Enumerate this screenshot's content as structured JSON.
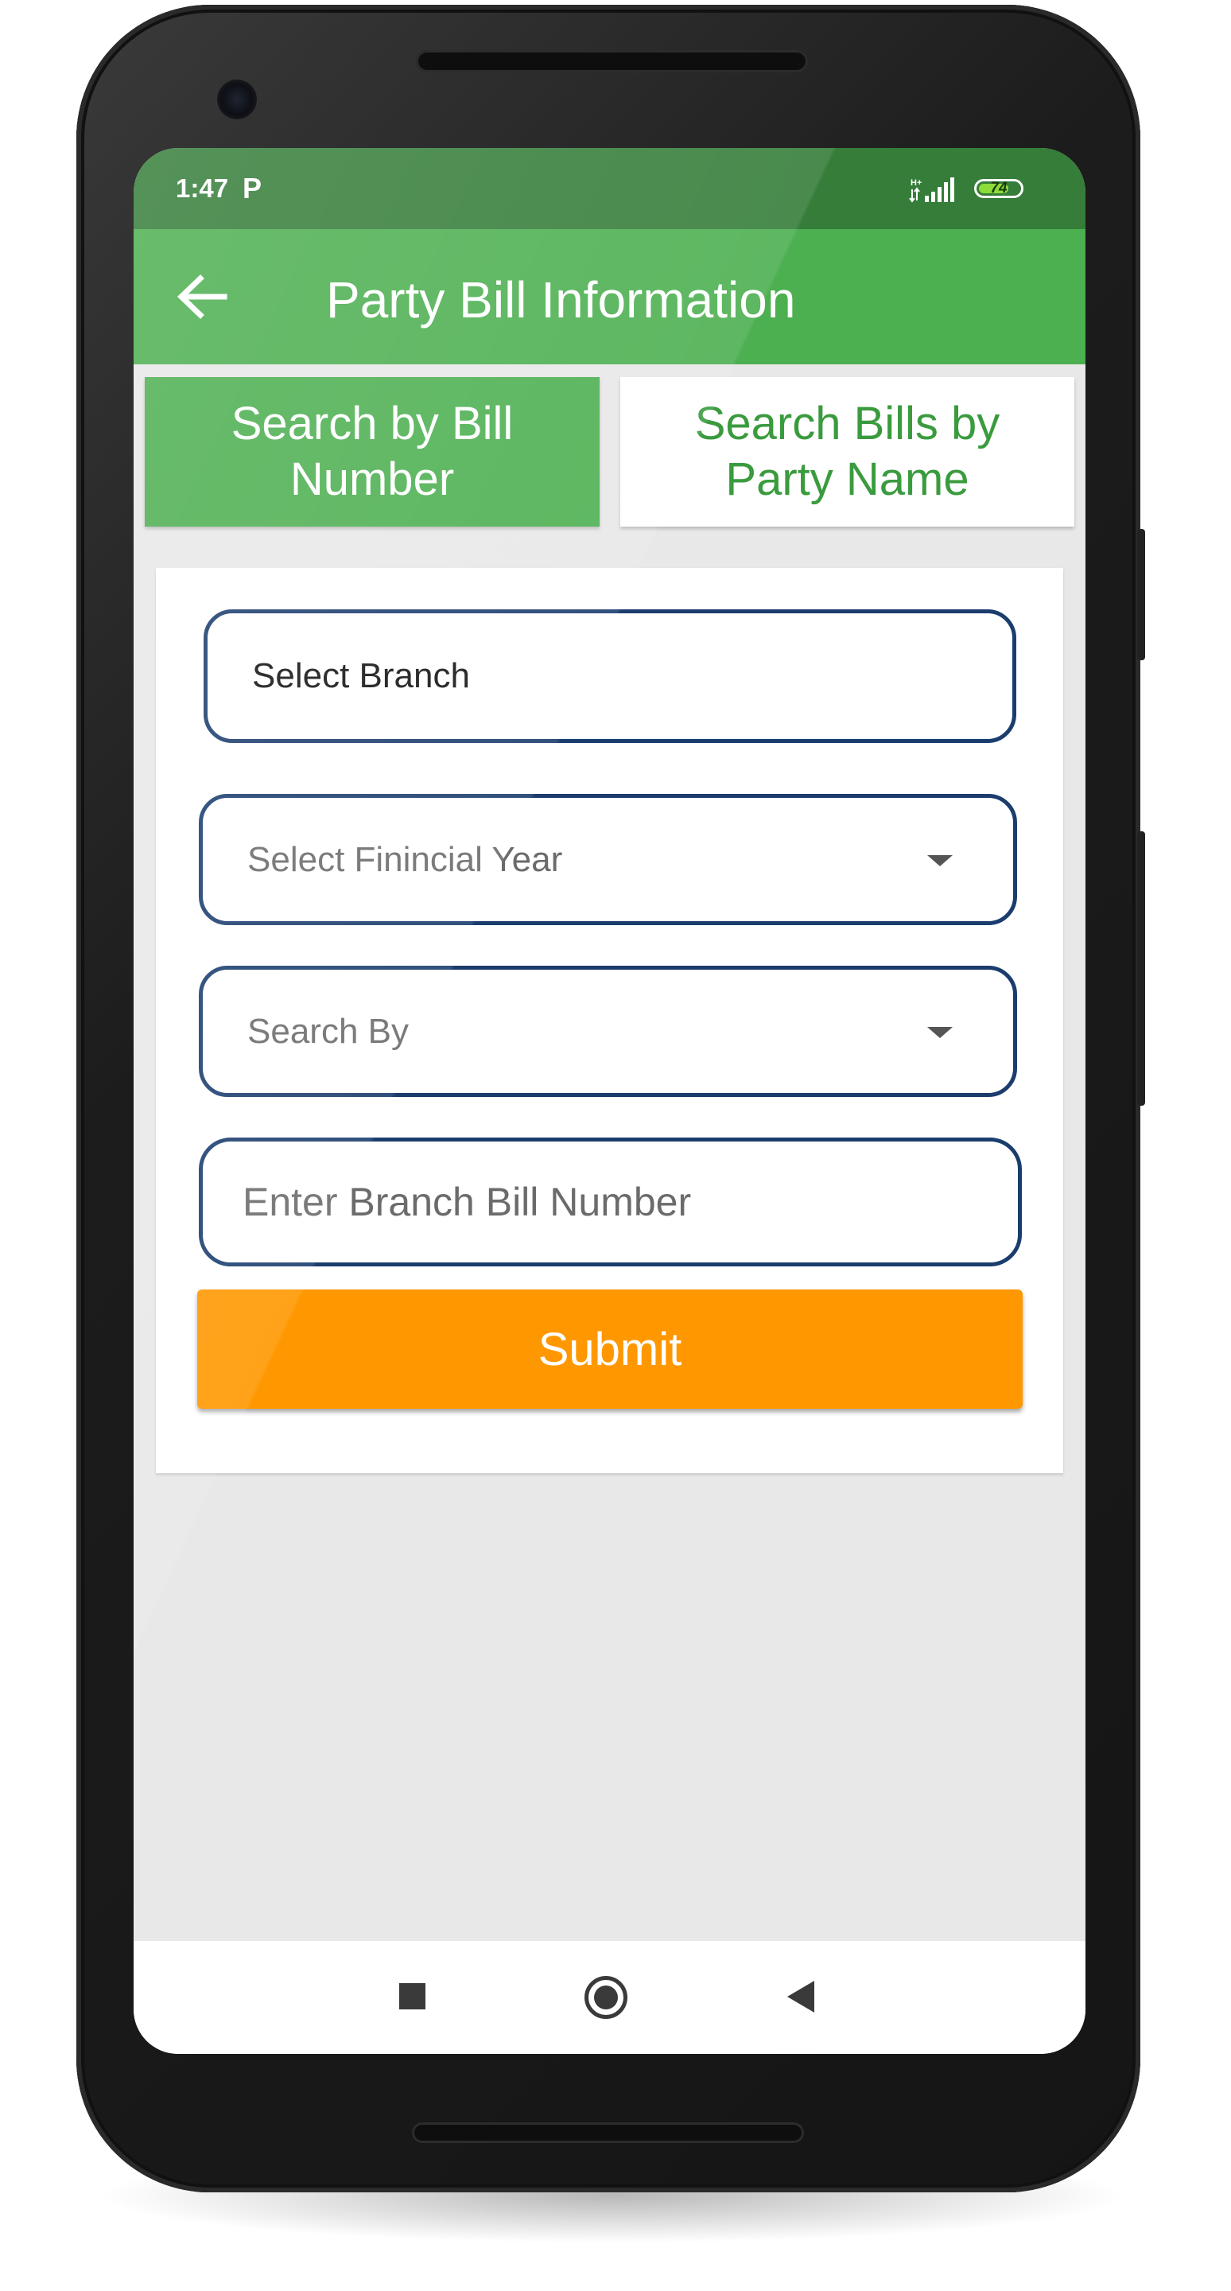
{
  "status_bar": {
    "time": "1:47",
    "notification_glyph": "P",
    "signal_icon": "signal-bars-icon",
    "battery_level": "74",
    "battery_fraction": 0.74,
    "colors": {
      "status_bg": "#357d39",
      "battery_fill": "#8ddc3a"
    }
  },
  "app_bar": {
    "back_icon": "arrow-left-icon",
    "title": "Party Bill Information",
    "color": "#4caf50"
  },
  "tabs": [
    {
      "label": "Search by Bill Number",
      "active": true
    },
    {
      "label": "Search Bills by Party Name",
      "active": false
    }
  ],
  "form": {
    "branch_label": "Select Branch",
    "financial_year_placeholder": "Select Finincial Year",
    "search_by_placeholder": "Search By",
    "bill_number_placeholder": "Enter Branch Bill Number",
    "bill_number_value": "",
    "submit_label": "Submit",
    "colors": {
      "field_border": "#1b3d6e",
      "submit": "#ff9800"
    }
  },
  "nav_bar": {
    "recents_icon": "square-icon",
    "home_icon": "circle-home-icon",
    "back_icon": "triangle-back-icon"
  }
}
